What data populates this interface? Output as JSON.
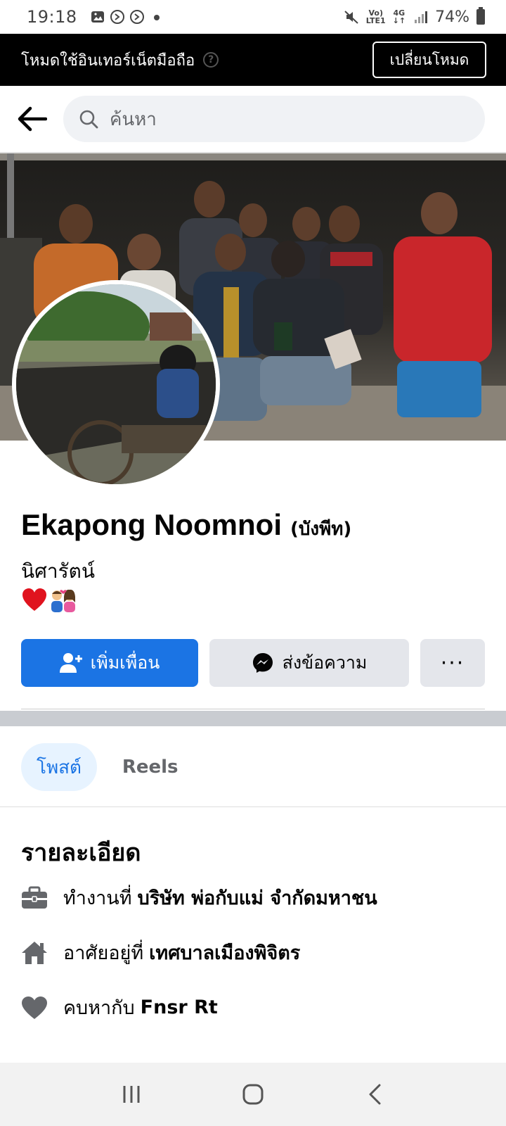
{
  "status_bar": {
    "time": "19:18",
    "network_line1": "Vo)",
    "network_line2": "LTE1",
    "network_type": "4G",
    "battery": "74%"
  },
  "banner": {
    "text": "โหมดใช้อินเทอร์เน็ตมือถือ",
    "button_label": "เปลี่ยนโหมด"
  },
  "search": {
    "placeholder": "ค้นหา"
  },
  "profile": {
    "name": "Ekapong Noomnoi",
    "alternate_name": "(บังพีท)",
    "bio": "นิศารัตน์",
    "bio_emoji": "❤️💑"
  },
  "actions": {
    "add_friend": "เพิ่มเพื่อน",
    "message": "ส่งข้อความ",
    "more": "···"
  },
  "tabs": [
    {
      "label": "โพสต์",
      "active": true
    },
    {
      "label": "Reels",
      "active": false
    }
  ],
  "details": {
    "title": "รายละเอียด",
    "items": [
      {
        "icon": "briefcase-icon",
        "prefix": "ทำงานที่",
        "value": "บริษัท พ่อกับแม่ จำกัดมหาชน"
      },
      {
        "icon": "home-icon",
        "prefix": "อาศัยอยู่ที่",
        "value": "เทศบาลเมืองพิจิตร"
      },
      {
        "icon": "heart-icon",
        "prefix": "คบหากับ",
        "value": "Fnsr Rt"
      }
    ]
  },
  "colors": {
    "accent": "#1b74e4",
    "button_gray": "#e4e6eb",
    "tab_active_bg": "#e7f3ff",
    "banner_bg": "#000000"
  }
}
